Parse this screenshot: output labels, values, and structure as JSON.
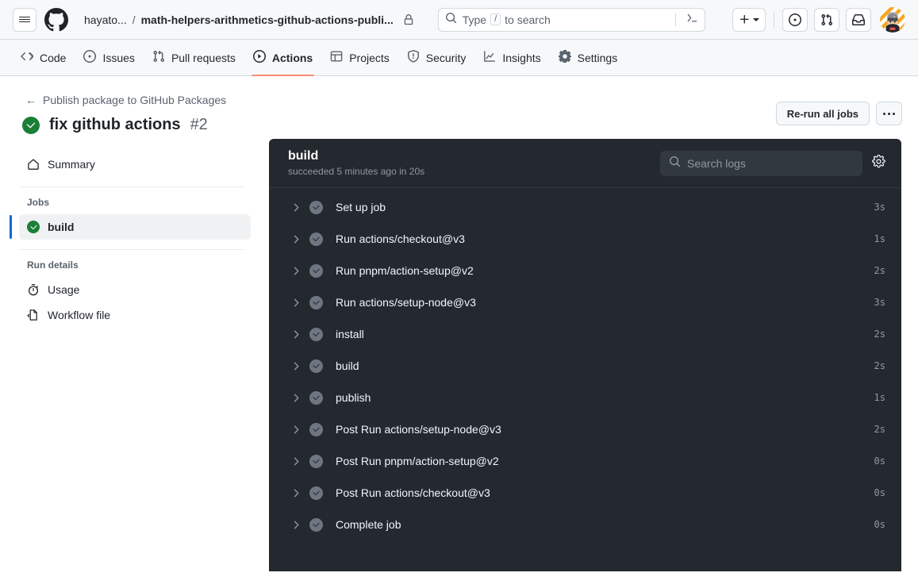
{
  "header": {
    "hamburger": "menu-icon",
    "logo": "github-logo",
    "breadcrumb": {
      "owner": "hayato...",
      "separator": "/",
      "repo": "math-helpers-arithmetics-github-actions-publi...",
      "visibility_icon": "lock-icon"
    },
    "search": {
      "placeholder_prefix": "Type",
      "slash_key": "/",
      "placeholder_suffix": "to search",
      "icon": "search-icon",
      "terminal_icon": "command-palette-icon"
    },
    "actions": {
      "create_new": "plus-icon",
      "issues": "issue-opened-icon",
      "pull_requests": "git-pull-request-icon",
      "notifications": "inbox-icon",
      "avatar": "user-avatar"
    }
  },
  "repo_nav": {
    "items": [
      {
        "label": "Code",
        "icon": "code-icon",
        "active": false
      },
      {
        "label": "Issues",
        "icon": "issue-opened-icon",
        "active": false
      },
      {
        "label": "Pull requests",
        "icon": "git-pull-request-icon",
        "active": false
      },
      {
        "label": "Actions",
        "icon": "play-icon",
        "active": true
      },
      {
        "label": "Projects",
        "icon": "table-icon",
        "active": false
      },
      {
        "label": "Security",
        "icon": "shield-icon",
        "active": false
      },
      {
        "label": "Insights",
        "icon": "graph-icon",
        "active": false
      },
      {
        "label": "Settings",
        "icon": "gear-icon",
        "active": false
      }
    ],
    "active_underline_color": "#fd8c73"
  },
  "run": {
    "back_label": "Publish package to GitHub Packages",
    "title": "fix github actions",
    "number": "#2",
    "status_icon": "check-circle-icon",
    "status_color": "#1a7f37",
    "rerun_label": "Re-run all jobs",
    "more_label": "kebab-menu"
  },
  "sidebar": {
    "summary": {
      "label": "Summary",
      "icon": "home-icon"
    },
    "jobs_heading": "Jobs",
    "jobs": [
      {
        "label": "build",
        "icon": "check-circle-icon",
        "selected": true
      }
    ],
    "run_details_heading": "Run details",
    "details": [
      {
        "label": "Usage",
        "icon": "stopwatch-icon"
      },
      {
        "label": "Workflow file",
        "icon": "workflow-file-icon"
      }
    ],
    "selected_indicator_color": "#0969da"
  },
  "logs": {
    "job_name": "build",
    "job_status": "succeeded 5 minutes ago in 20s",
    "search_placeholder": "Search logs",
    "search_icon": "search-icon",
    "settings_icon": "gear-icon",
    "background": "#24292f",
    "steps": [
      {
        "name": "Set up job",
        "duration": "3s",
        "status": "success"
      },
      {
        "name": "Run actions/checkout@v3",
        "duration": "1s",
        "status": "success"
      },
      {
        "name": "Run pnpm/action-setup@v2",
        "duration": "2s",
        "status": "success"
      },
      {
        "name": "Run actions/setup-node@v3",
        "duration": "3s",
        "status": "success"
      },
      {
        "name": "install",
        "duration": "2s",
        "status": "success"
      },
      {
        "name": "build",
        "duration": "2s",
        "status": "success"
      },
      {
        "name": "publish",
        "duration": "1s",
        "status": "success"
      },
      {
        "name": "Post Run actions/setup-node@v3",
        "duration": "2s",
        "status": "success"
      },
      {
        "name": "Post Run pnpm/action-setup@v2",
        "duration": "0s",
        "status": "success"
      },
      {
        "name": "Post Run actions/checkout@v3",
        "duration": "0s",
        "status": "success"
      },
      {
        "name": "Complete job",
        "duration": "0s",
        "status": "success"
      }
    ]
  }
}
